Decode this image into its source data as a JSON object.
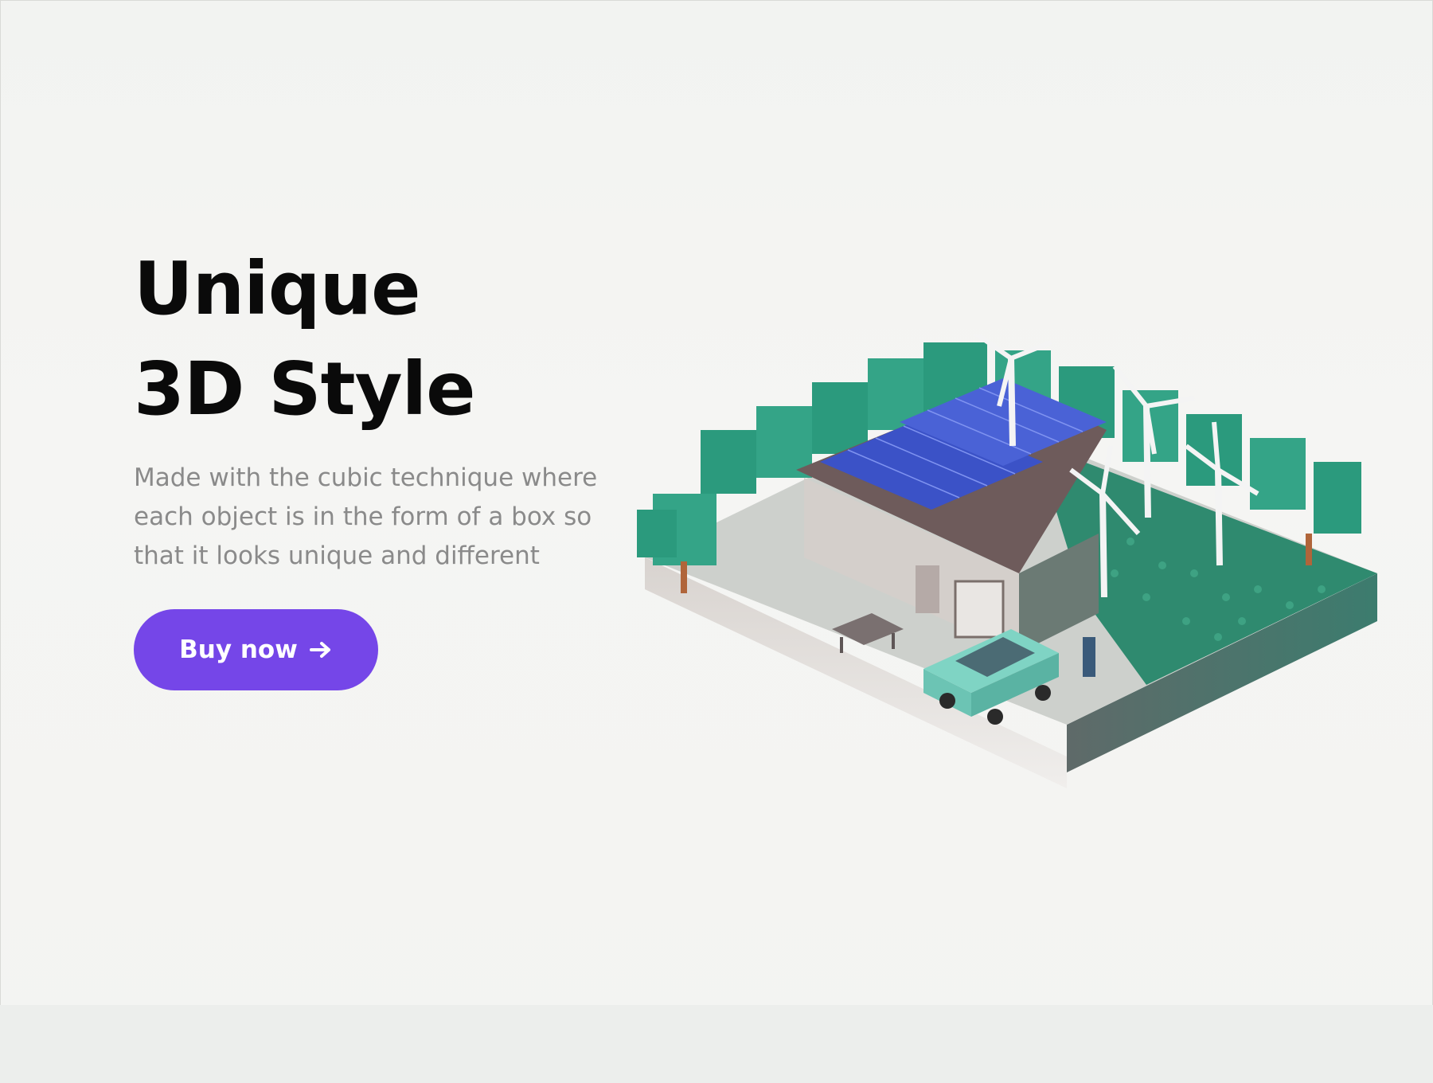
{
  "hero": {
    "title_line1": "Unique",
    "title_line2": "3D Style",
    "description": "Made with the cubic technique where each object is in the form of a box so that it looks unique and different",
    "button_label": "Buy now",
    "button_icon": "arrow-right-icon"
  },
  "colors": {
    "accent": "#7546e8",
    "title": "#0a0a0a",
    "body_text": "#8a8a8a",
    "background": "#f3f4f2"
  },
  "illustration": {
    "subject": "isometric-eco-house-with-solar-panels-wind-turbines-trees-and-car"
  }
}
